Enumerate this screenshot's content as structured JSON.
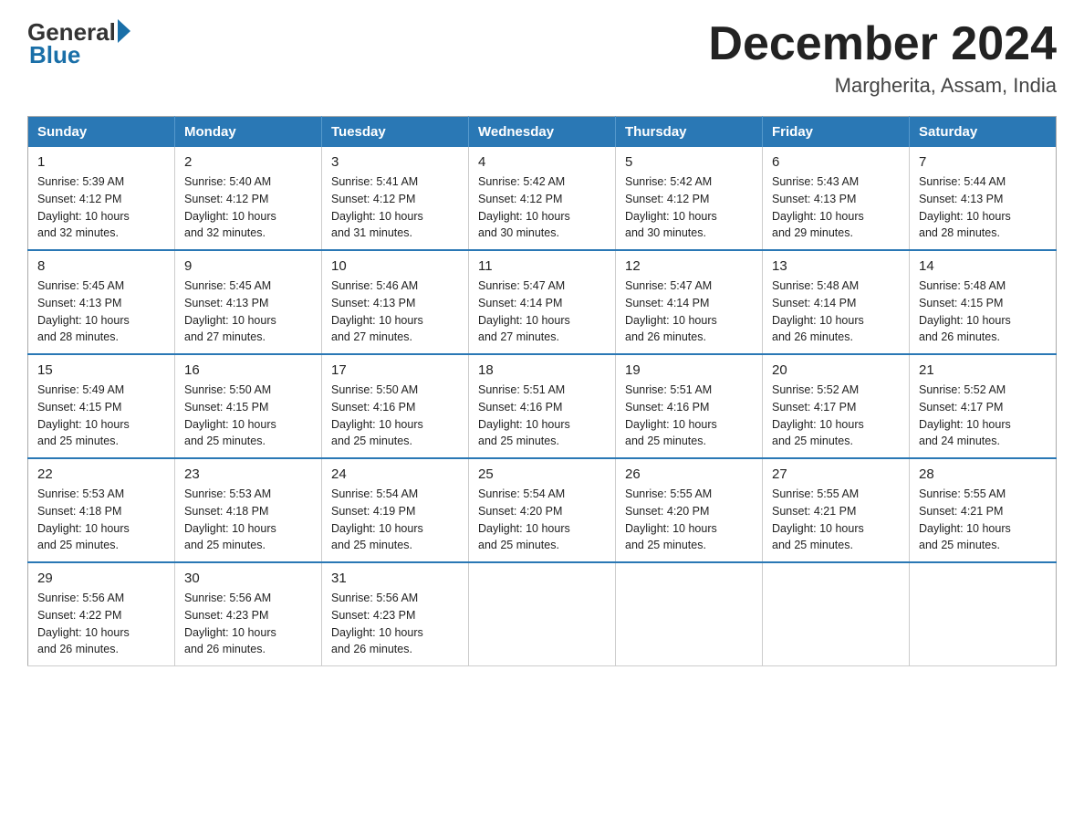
{
  "header": {
    "logo_general": "General",
    "logo_blue": "Blue",
    "title": "December 2024",
    "subtitle": "Margherita, Assam, India"
  },
  "weekdays": [
    "Sunday",
    "Monday",
    "Tuesday",
    "Wednesday",
    "Thursday",
    "Friday",
    "Saturday"
  ],
  "weeks": [
    [
      {
        "day": "1",
        "sunrise": "5:39 AM",
        "sunset": "4:12 PM",
        "daylight": "10 hours and 32 minutes."
      },
      {
        "day": "2",
        "sunrise": "5:40 AM",
        "sunset": "4:12 PM",
        "daylight": "10 hours and 32 minutes."
      },
      {
        "day": "3",
        "sunrise": "5:41 AM",
        "sunset": "4:12 PM",
        "daylight": "10 hours and 31 minutes."
      },
      {
        "day": "4",
        "sunrise": "5:42 AM",
        "sunset": "4:12 PM",
        "daylight": "10 hours and 30 minutes."
      },
      {
        "day": "5",
        "sunrise": "5:42 AM",
        "sunset": "4:12 PM",
        "daylight": "10 hours and 30 minutes."
      },
      {
        "day": "6",
        "sunrise": "5:43 AM",
        "sunset": "4:13 PM",
        "daylight": "10 hours and 29 minutes."
      },
      {
        "day": "7",
        "sunrise": "5:44 AM",
        "sunset": "4:13 PM",
        "daylight": "10 hours and 28 minutes."
      }
    ],
    [
      {
        "day": "8",
        "sunrise": "5:45 AM",
        "sunset": "4:13 PM",
        "daylight": "10 hours and 28 minutes."
      },
      {
        "day": "9",
        "sunrise": "5:45 AM",
        "sunset": "4:13 PM",
        "daylight": "10 hours and 27 minutes."
      },
      {
        "day": "10",
        "sunrise": "5:46 AM",
        "sunset": "4:13 PM",
        "daylight": "10 hours and 27 minutes."
      },
      {
        "day": "11",
        "sunrise": "5:47 AM",
        "sunset": "4:14 PM",
        "daylight": "10 hours and 27 minutes."
      },
      {
        "day": "12",
        "sunrise": "5:47 AM",
        "sunset": "4:14 PM",
        "daylight": "10 hours and 26 minutes."
      },
      {
        "day": "13",
        "sunrise": "5:48 AM",
        "sunset": "4:14 PM",
        "daylight": "10 hours and 26 minutes."
      },
      {
        "day": "14",
        "sunrise": "5:48 AM",
        "sunset": "4:15 PM",
        "daylight": "10 hours and 26 minutes."
      }
    ],
    [
      {
        "day": "15",
        "sunrise": "5:49 AM",
        "sunset": "4:15 PM",
        "daylight": "10 hours and 25 minutes."
      },
      {
        "day": "16",
        "sunrise": "5:50 AM",
        "sunset": "4:15 PM",
        "daylight": "10 hours and 25 minutes."
      },
      {
        "day": "17",
        "sunrise": "5:50 AM",
        "sunset": "4:16 PM",
        "daylight": "10 hours and 25 minutes."
      },
      {
        "day": "18",
        "sunrise": "5:51 AM",
        "sunset": "4:16 PM",
        "daylight": "10 hours and 25 minutes."
      },
      {
        "day": "19",
        "sunrise": "5:51 AM",
        "sunset": "4:16 PM",
        "daylight": "10 hours and 25 minutes."
      },
      {
        "day": "20",
        "sunrise": "5:52 AM",
        "sunset": "4:17 PM",
        "daylight": "10 hours and 25 minutes."
      },
      {
        "day": "21",
        "sunrise": "5:52 AM",
        "sunset": "4:17 PM",
        "daylight": "10 hours and 24 minutes."
      }
    ],
    [
      {
        "day": "22",
        "sunrise": "5:53 AM",
        "sunset": "4:18 PM",
        "daylight": "10 hours and 25 minutes."
      },
      {
        "day": "23",
        "sunrise": "5:53 AM",
        "sunset": "4:18 PM",
        "daylight": "10 hours and 25 minutes."
      },
      {
        "day": "24",
        "sunrise": "5:54 AM",
        "sunset": "4:19 PM",
        "daylight": "10 hours and 25 minutes."
      },
      {
        "day": "25",
        "sunrise": "5:54 AM",
        "sunset": "4:20 PM",
        "daylight": "10 hours and 25 minutes."
      },
      {
        "day": "26",
        "sunrise": "5:55 AM",
        "sunset": "4:20 PM",
        "daylight": "10 hours and 25 minutes."
      },
      {
        "day": "27",
        "sunrise": "5:55 AM",
        "sunset": "4:21 PM",
        "daylight": "10 hours and 25 minutes."
      },
      {
        "day": "28",
        "sunrise": "5:55 AM",
        "sunset": "4:21 PM",
        "daylight": "10 hours and 25 minutes."
      }
    ],
    [
      {
        "day": "29",
        "sunrise": "5:56 AM",
        "sunset": "4:22 PM",
        "daylight": "10 hours and 26 minutes."
      },
      {
        "day": "30",
        "sunrise": "5:56 AM",
        "sunset": "4:23 PM",
        "daylight": "10 hours and 26 minutes."
      },
      {
        "day": "31",
        "sunrise": "5:56 AM",
        "sunset": "4:23 PM",
        "daylight": "10 hours and 26 minutes."
      },
      null,
      null,
      null,
      null
    ]
  ],
  "labels": {
    "sunrise": "Sunrise:",
    "sunset": "Sunset:",
    "daylight": "Daylight:"
  }
}
